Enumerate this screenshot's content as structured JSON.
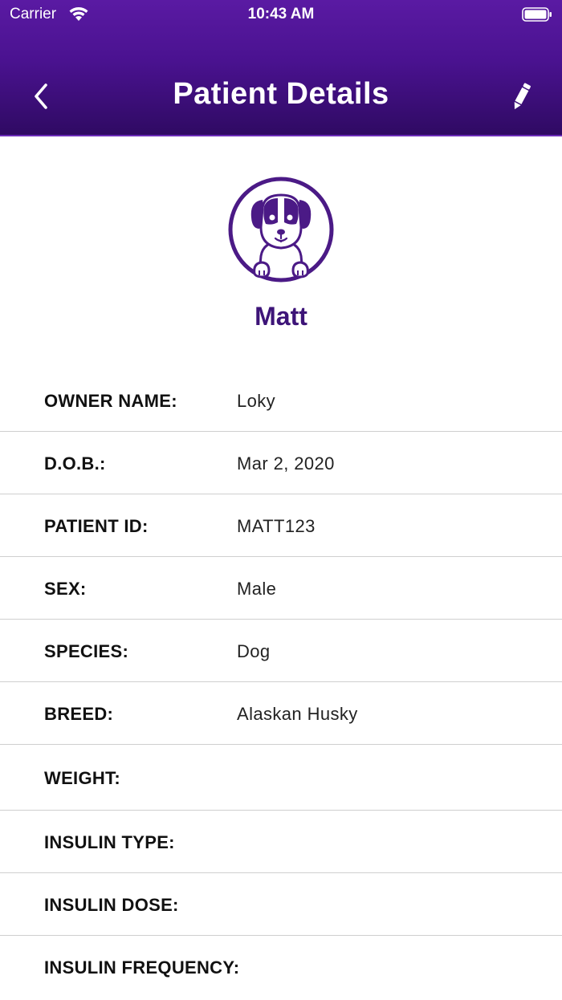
{
  "status_bar": {
    "carrier": "Carrier",
    "time": "10:43 AM"
  },
  "nav": {
    "title": "Patient Details",
    "back_icon": "chevron-left-icon",
    "edit_icon": "pencil-icon"
  },
  "patient": {
    "name": "Matt",
    "avatar_icon": "dog-avatar-icon"
  },
  "colors": {
    "header_top": "#5a1aa3",
    "header_bottom": "#2f0a63",
    "accent": "#4b1a86"
  },
  "details": [
    {
      "label": "OWNER NAME:",
      "value": "Loky"
    },
    {
      "label": "D.O.B.:",
      "value": "Mar 2, 2020"
    },
    {
      "label": "PATIENT ID:",
      "value": "MATT123"
    },
    {
      "label": "SEX:",
      "value": "Male"
    },
    {
      "label": "SPECIES:",
      "value": "Dog"
    },
    {
      "label": "BREED:",
      "value": "Alaskan Husky"
    },
    {
      "label": "WEIGHT:",
      "value": ""
    },
    {
      "label": "INSULIN TYPE:",
      "value": ""
    },
    {
      "label": "INSULIN DOSE:",
      "value": ""
    },
    {
      "label": "INSULIN FREQUENCY:",
      "value": ""
    }
  ]
}
